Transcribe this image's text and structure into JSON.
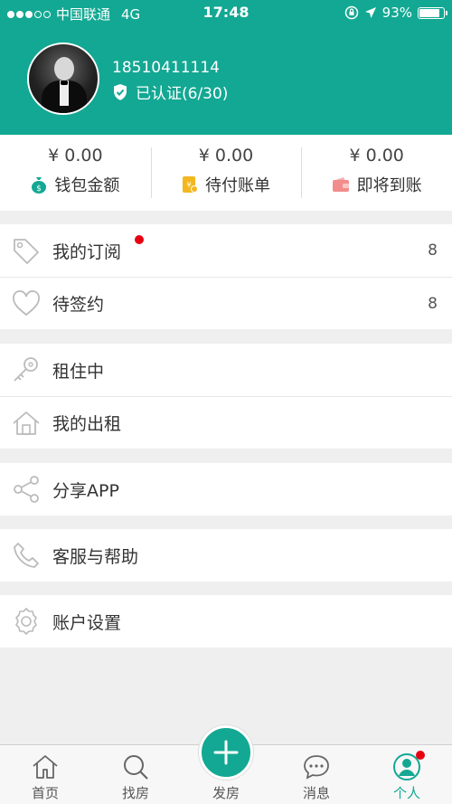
{
  "status_bar": {
    "carrier": "中国联通",
    "network": "4G",
    "time": "17:48",
    "battery": "93%",
    "battery_level": 0.93
  },
  "profile": {
    "phone": "18510411114",
    "verified_text": "已认证(6/30)"
  },
  "balances": [
    {
      "amount": "¥ 0.00",
      "label": "钱包金额",
      "icon": "money-bag-icon",
      "color": "#13a893"
    },
    {
      "amount": "¥ 0.00",
      "label": "待付账单",
      "icon": "bill-icon",
      "color": "#f3b71f"
    },
    {
      "amount": "¥ 0.00",
      "label": "即将到账",
      "icon": "wallet-icon",
      "color": "#f28c8c"
    }
  ],
  "menu": {
    "subscriptions": {
      "label": "我的订阅",
      "count": "8",
      "icon": "tag-icon"
    },
    "to_sign": {
      "label": "待签约",
      "count": "8",
      "icon": "heart-icon"
    },
    "renting": {
      "label": "租住中",
      "icon": "key-icon"
    },
    "my_rentals": {
      "label": "我的出租",
      "icon": "house-icon"
    },
    "share": {
      "label": "分享APP",
      "icon": "share-icon"
    },
    "help": {
      "label": "客服与帮助",
      "icon": "phone-icon"
    },
    "settings": {
      "label": "账户设置",
      "icon": "gear-icon"
    }
  },
  "tabbar": {
    "home": "首页",
    "search": "找房",
    "post": "发房",
    "messages": "消息",
    "profile": "个人"
  },
  "colors": {
    "accent": "#13a893",
    "badge": "#e60012"
  }
}
